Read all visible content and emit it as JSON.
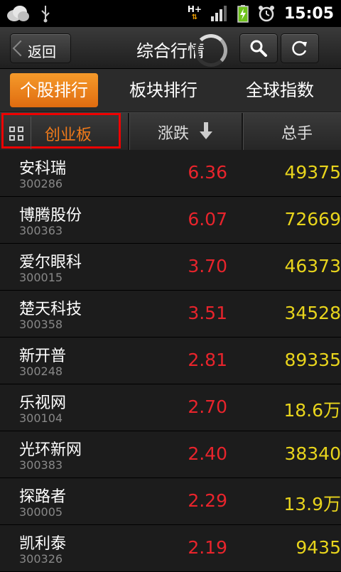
{
  "status_bar": {
    "time": "15:05",
    "network": "H+"
  },
  "header": {
    "back_label": "返回",
    "title": "综合行情"
  },
  "tabs": [
    {
      "label": "个股排行",
      "active": true
    },
    {
      "label": "板块排行",
      "active": false
    },
    {
      "label": "全球指数",
      "active": false
    }
  ],
  "columns": {
    "board": "创业板",
    "change": "涨跌",
    "volume": "总手"
  },
  "rows": [
    {
      "name": "安科瑞",
      "code": "300286",
      "change": "6.36",
      "volume": "49375"
    },
    {
      "name": "博腾股份",
      "code": "300363",
      "change": "6.07",
      "volume": "72669"
    },
    {
      "name": "爱尔眼科",
      "code": "300015",
      "change": "3.70",
      "volume": "46373"
    },
    {
      "name": "楚天科技",
      "code": "300358",
      "change": "3.51",
      "volume": "34528"
    },
    {
      "name": "新开普",
      "code": "300248",
      "change": "2.81",
      "volume": "89335"
    },
    {
      "name": "乐视网",
      "code": "300104",
      "change": "2.70",
      "volume": "18.6万"
    },
    {
      "name": "光环新网",
      "code": "300383",
      "change": "2.40",
      "volume": "38340"
    },
    {
      "name": "探路者",
      "code": "300005",
      "change": "2.29",
      "volume": "13.9万"
    },
    {
      "name": "凯利泰",
      "code": "300326",
      "change": "2.19",
      "volume": "9435"
    }
  ],
  "colors": {
    "accent": "#f07a1a",
    "up": "#e8242c",
    "volume": "#e8d41c",
    "highlight_box": "#ee0000"
  }
}
